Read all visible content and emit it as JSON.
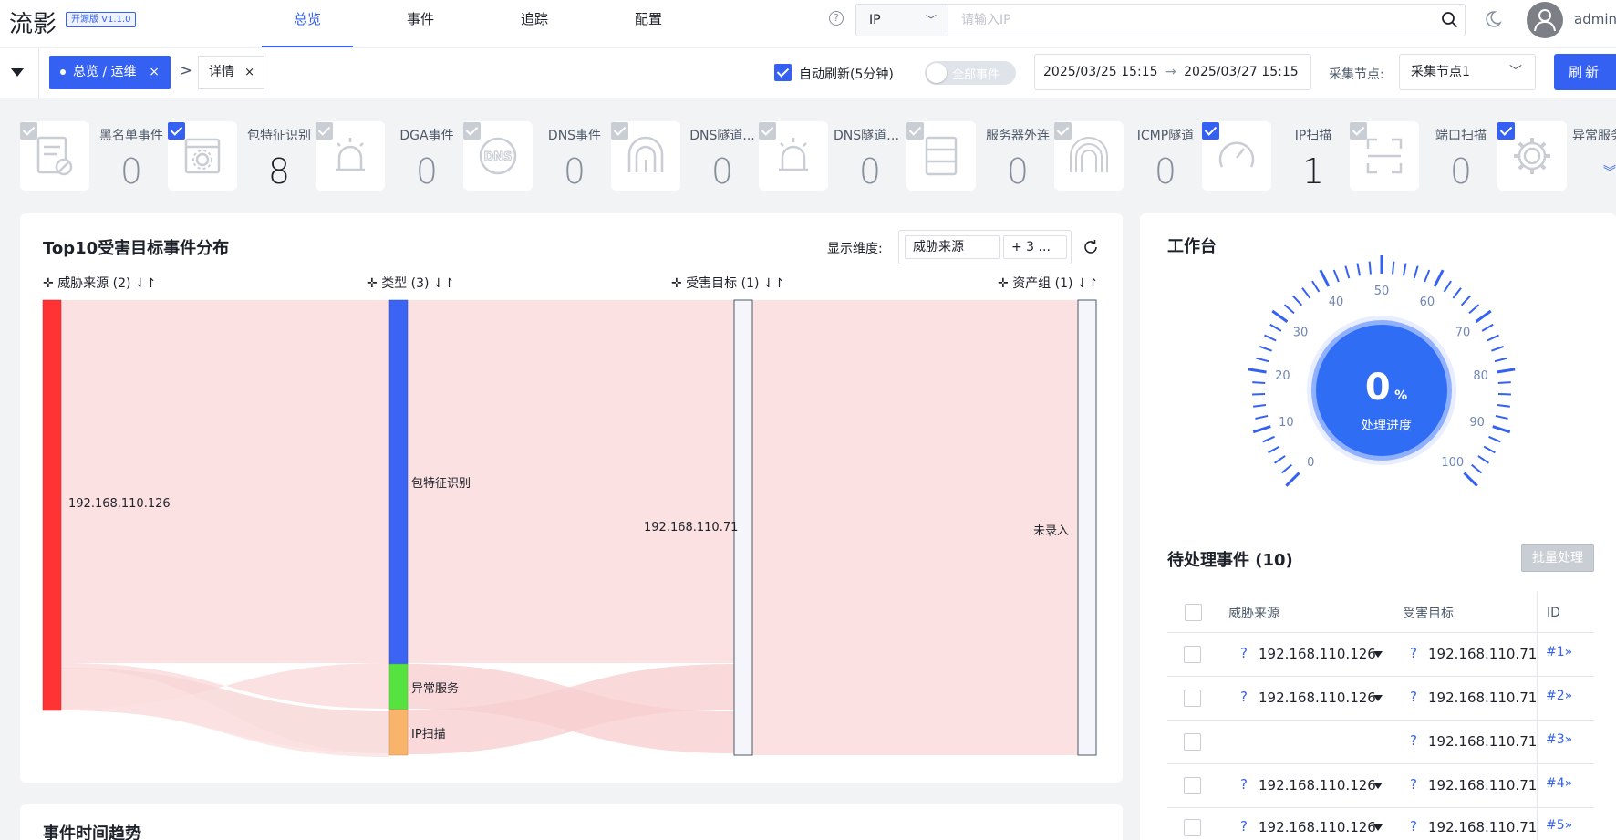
{
  "header": {
    "logo": "流影",
    "version": "开源版 V1.1.0",
    "tabs": [
      {
        "label": "总览",
        "active": true
      },
      {
        "label": "事件",
        "active": false
      },
      {
        "label": "追踪",
        "active": false
      },
      {
        "label": "配置",
        "active": false
      }
    ],
    "search_type": "IP",
    "search_placeholder": "请输入IP",
    "user": "admin"
  },
  "toolbar": {
    "breadcrumb_active": "总览 / 运维",
    "breadcrumb_detail": "详情",
    "close_glyph": "×",
    "auto_refresh_label": "自动刷新(5分钟)",
    "all_events_label": "全部事件",
    "date_start": "2025/03/25 15:15",
    "date_end": "2025/03/27 15:15",
    "date_arrow": "→",
    "node_label": "采集节点:",
    "node_value": "采集节点1",
    "refresh_label": "刷新"
  },
  "event_cards": [
    {
      "name": "黑名单事件",
      "value": "0",
      "checked": false,
      "icon": "blacklist-icon"
    },
    {
      "name": "包特征识别",
      "value": "8",
      "checked": true,
      "icon": "packet-feature-icon"
    },
    {
      "name": "DGA事件",
      "value": "0",
      "checked": false,
      "icon": "alarm-icon"
    },
    {
      "name": "DNS事件",
      "value": "0",
      "checked": false,
      "icon": "dns-icon"
    },
    {
      "name": "DNS隧道...",
      "value": "0",
      "checked": false,
      "icon": "tunnel-icon"
    },
    {
      "name": "DNS隧道A...",
      "value": "0",
      "checked": false,
      "icon": "alarm-icon"
    },
    {
      "name": "服务器外连",
      "value": "0",
      "checked": false,
      "icon": "server-icon"
    },
    {
      "name": "ICMP隧道",
      "value": "0",
      "checked": false,
      "icon": "tunnel-icon"
    },
    {
      "name": "IP扫描",
      "value": "1",
      "checked": true,
      "icon": "gauge-icon"
    },
    {
      "name": "端口扫描",
      "value": "0",
      "checked": false,
      "icon": "scan-icon"
    },
    {
      "name": "异常服务",
      "value": "",
      "checked": true,
      "icon": "gear-icon"
    }
  ],
  "sankey_panel": {
    "title": "Top10受害目标事件分布",
    "dim_label": "显示维度:",
    "dim_tag1": "威胁来源",
    "dim_tag2": "+ 3 ...",
    "columns": [
      {
        "label": "威胁来源 (2)"
      },
      {
        "label": "类型 (3)"
      },
      {
        "label": "受害目标 (1)"
      },
      {
        "label": "资产组 (1)"
      }
    ],
    "nodes": {
      "source": "192.168.110.126",
      "type1": "包特征识别",
      "type2": "异常服务",
      "type3": "IP扫描",
      "target": "192.168.110.71",
      "asset": "未录入"
    },
    "colors": {
      "source": "#ff3333",
      "type1": "#3b64f5",
      "type2": "#57e33f",
      "type3": "#f9b46b",
      "link": "#fbe1e1"
    }
  },
  "trend_title": "事件时间趋势",
  "workbench": {
    "title": "工作台",
    "progress": 0,
    "progress_unit": "%",
    "progress_label": "处理进度",
    "gauge_ticks": [
      "0",
      "10",
      "20",
      "30",
      "40",
      "50",
      "60",
      "70",
      "80",
      "90",
      "100"
    ],
    "pending_title": "待处理事件 (10)",
    "batch_label": "批量处理",
    "columns": {
      "source": "威胁来源",
      "target": "受害目标",
      "id": "ID"
    },
    "rows": [
      {
        "source": "192.168.110.126",
        "target": "192.168.110.71",
        "id": "#1»"
      },
      {
        "source": "192.168.110.126",
        "target": "192.168.110.71",
        "id": "#2»"
      },
      {
        "source": "",
        "target": "192.168.110.71",
        "id": "#3»"
      },
      {
        "source": "192.168.110.126",
        "target": "192.168.110.71",
        "id": "#4»"
      },
      {
        "source": "192.168.110.126",
        "target": "192.168.110.71",
        "id": "#5»"
      }
    ]
  }
}
